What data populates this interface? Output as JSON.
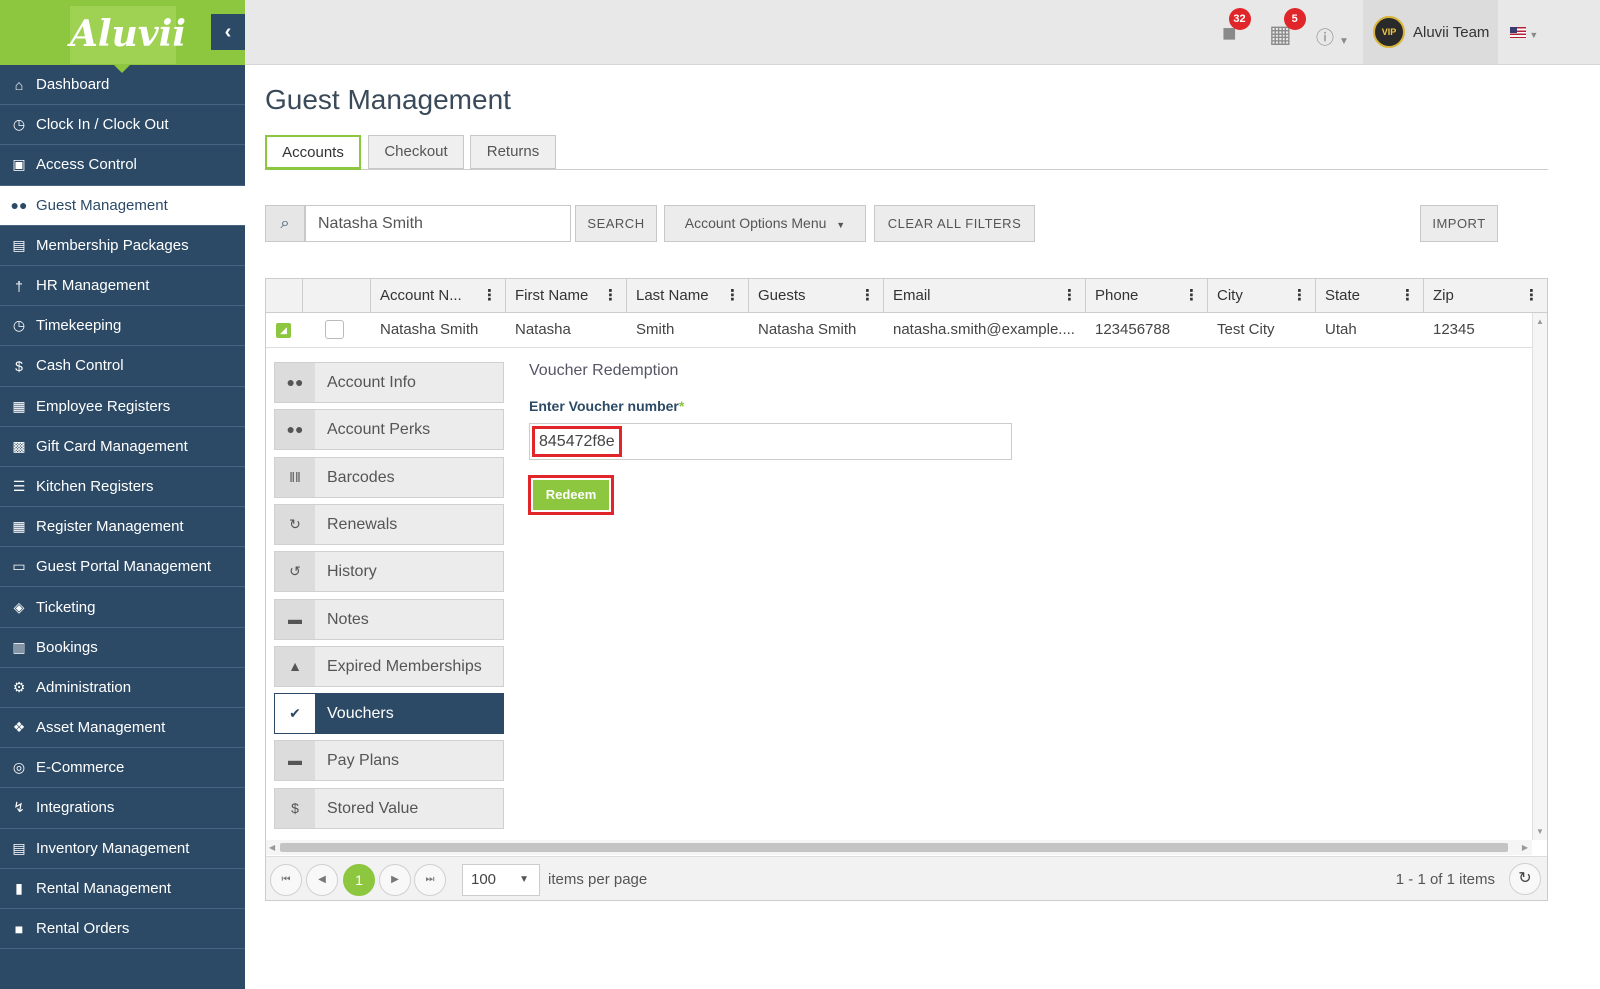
{
  "brand": {
    "logo_text": "Aluvii",
    "accent": "#8dc63f",
    "nav_bg": "#2c4a66",
    "alert": "#e0262a"
  },
  "sidebar": {
    "collapse_icon": "chevron-left-icon",
    "items": [
      {
        "label": "Dashboard",
        "icon": "home-icon"
      },
      {
        "label": "Clock In / Clock Out",
        "icon": "clock-icon"
      },
      {
        "label": "Access Control",
        "icon": "lock-icon"
      },
      {
        "label": "Guest Management",
        "icon": "users-icon",
        "active": true
      },
      {
        "label": "Membership Packages",
        "icon": "package-icon"
      },
      {
        "label": "HR Management",
        "icon": "person-icon"
      },
      {
        "label": "Timekeeping",
        "icon": "clock-icon"
      },
      {
        "label": "Cash Control",
        "icon": "dollar-icon"
      },
      {
        "label": "Employee Registers",
        "icon": "cart-icon"
      },
      {
        "label": "Gift Card Management",
        "icon": "gift-icon"
      },
      {
        "label": "Kitchen Registers",
        "icon": "list-icon"
      },
      {
        "label": "Register Management",
        "icon": "cart-icon"
      },
      {
        "label": "Guest Portal Management",
        "icon": "laptop-icon"
      },
      {
        "label": "Ticketing",
        "icon": "ticket-icon"
      },
      {
        "label": "Bookings",
        "icon": "calendar-icon"
      },
      {
        "label": "Administration",
        "icon": "gears-icon"
      },
      {
        "label": "Asset Management",
        "icon": "cubes-icon"
      },
      {
        "label": "E-Commerce",
        "icon": "globe-icon"
      },
      {
        "label": "Integrations",
        "icon": "bolt-icon"
      },
      {
        "label": "Inventory Management",
        "icon": "archive-icon"
      },
      {
        "label": "Rental Management",
        "icon": "clipboard-icon"
      },
      {
        "label": "Rental Orders",
        "icon": "book-icon"
      }
    ]
  },
  "topbar": {
    "bag_badge": "32",
    "cart_badge": "5",
    "help_icon": "question-circle-icon",
    "user_avatar_text": "VIP",
    "user_name": "Aluvii Team",
    "language_icon": "us-flag-icon"
  },
  "page": {
    "title": "Guest Management",
    "tabs": [
      {
        "label": "Accounts",
        "active": true
      },
      {
        "label": "Checkout"
      },
      {
        "label": "Returns"
      }
    ]
  },
  "toolbar": {
    "search_value": "Natasha Smith",
    "search_button": "SEARCH",
    "options_menu": "Account Options Menu",
    "clear_filters": "CLEAR ALL FILTERS",
    "import": "IMPORT"
  },
  "grid": {
    "columns": [
      "Account N...",
      "First Name",
      "Last Name",
      "Guests",
      "Email",
      "Phone",
      "City",
      "State",
      "Zip"
    ],
    "row": {
      "account_name": "Natasha Smith",
      "first_name": "Natasha",
      "last_name": "Smith",
      "guests": "Natasha Smith",
      "email": "natasha.smith@example....",
      "phone": "123456788",
      "city": "Test City",
      "state": "Utah",
      "zip": "12345"
    }
  },
  "detail": {
    "menu": [
      {
        "label": "Account Info",
        "icon": "users-icon"
      },
      {
        "label": "Account Perks",
        "icon": "users-icon"
      },
      {
        "label": "Barcodes",
        "icon": "barcode-icon"
      },
      {
        "label": "Renewals",
        "icon": "refresh-icon"
      },
      {
        "label": "History",
        "icon": "history-icon"
      },
      {
        "label": "Notes",
        "icon": "comments-icon"
      },
      {
        "label": "Expired Memberships",
        "icon": "warning-icon"
      },
      {
        "label": "Vouchers",
        "icon": "check-icon",
        "active": true
      },
      {
        "label": "Pay Plans",
        "icon": "credit-card-icon"
      },
      {
        "label": "Stored Value",
        "icon": "dollar-icon"
      }
    ],
    "voucher": {
      "title": "Voucher Redemption",
      "label": "Enter Voucher number",
      "required_mark": "*",
      "value": "845472f8e",
      "redeem_button": "Redeem"
    }
  },
  "pager": {
    "current_page": "1",
    "page_size": "100",
    "per_page_label": "items per page",
    "item_count": "1 - 1 of 1 items"
  }
}
